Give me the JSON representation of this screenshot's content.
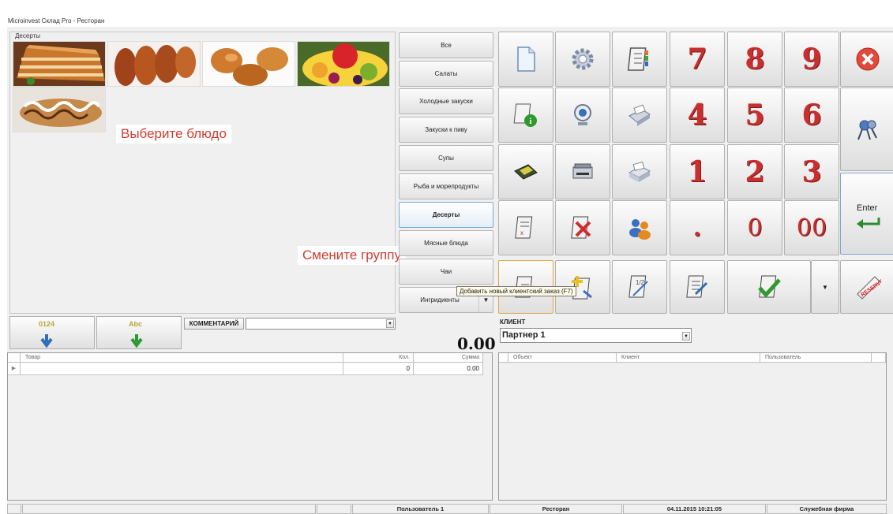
{
  "window": {
    "title": "Microinvest Склад Pro - Ресторан"
  },
  "dish_panel": {
    "group_name": "Десерты",
    "hint": "Выберите блюдо",
    "dishes": [
      "cake-slice",
      "pirozhki",
      "buns",
      "fruit-salad",
      "cream-roll"
    ]
  },
  "group_hint": "Смените группу",
  "groups": [
    {
      "label": "Все",
      "selected": false
    },
    {
      "label": "Салаты",
      "selected": false
    },
    {
      "label": "Холодные закуски",
      "selected": false
    },
    {
      "label": "Закуски к пиву",
      "selected": false
    },
    {
      "label": "Супы",
      "selected": false
    },
    {
      "label": "Рыба и морепродукты",
      "selected": false
    },
    {
      "label": "Десерты",
      "selected": true
    },
    {
      "label": "Мясные блюда",
      "selected": false
    },
    {
      "label": "Чаи",
      "selected": false
    },
    {
      "label": "Ингридиенты",
      "selected": false
    }
  ],
  "keypad": {
    "digits": [
      "7",
      "8",
      "9",
      "4",
      "5",
      "6",
      "1",
      "2",
      "3",
      ".",
      "0",
      "00"
    ],
    "enter_label": "Enter"
  },
  "tooltip": "Добавить новый клиентский заказ  (F7)",
  "order": {
    "sort_code_label": "0124",
    "sort_alpha_label": "Abc",
    "comment_label": "КОММЕНТАРИЙ",
    "comment_value": "",
    "total": "0.00",
    "columns": [
      "Товар",
      "Кол.",
      "Сумма"
    ],
    "rows": [
      {
        "item": "",
        "qty": "0",
        "sum": "0.00"
      }
    ]
  },
  "client": {
    "label": "КЛИЕНТ",
    "value": "Партнер 1",
    "columns": [
      "Объект",
      "Клиент",
      "Пользователь"
    ]
  },
  "status_bar": {
    "user": "Пользователь 1",
    "object": "Ресторан",
    "datetime": "04.11.2015 10:21:05",
    "company": "Служебная фирма"
  },
  "colors": {
    "digit": "#c92f2f",
    "hint": "#d63a2f",
    "accent": "#7aa7d9"
  }
}
